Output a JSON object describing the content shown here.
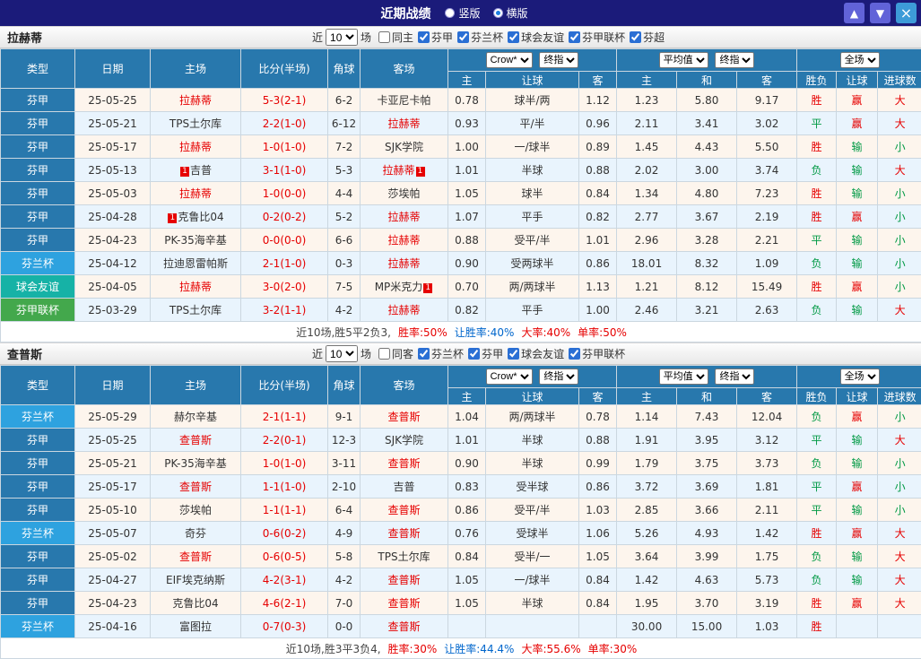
{
  "colors": {
    "win": "#e60000",
    "lose": "#009944",
    "blue": "#0066cc",
    "dark": "#444444"
  },
  "titlebar": {
    "title": "近期战绩",
    "radios": [
      {
        "label": "竖版",
        "selected": false
      },
      {
        "label": "横版",
        "selected": true
      }
    ],
    "buttons": {
      "up": "▲",
      "down": "▼",
      "close": "×"
    }
  },
  "sections": [
    {
      "team": "拉赫蒂",
      "filter": {
        "near": "近",
        "count": "10",
        "games": "场",
        "checks": [
          {
            "label": "同主",
            "checked": false
          },
          {
            "label": "芬甲",
            "checked": true
          },
          {
            "label": "芬兰杯",
            "checked": true
          },
          {
            "label": "球会友谊",
            "checked": true
          },
          {
            "label": "芬甲联杯",
            "checked": true
          },
          {
            "label": "芬超",
            "checked": true
          }
        ]
      },
      "header": {
        "type": "类型",
        "date": "日期",
        "home": "主场",
        "score": "比分(半场)",
        "corner": "角球",
        "away": "客场",
        "odds_selects": [
          "Crow*",
          "终指"
        ],
        "avg_selects": [
          "平均值",
          "终指"
        ],
        "full_select": "全场",
        "sub": [
          "主",
          "让球",
          "客",
          "主",
          "和",
          "客",
          "胜负",
          "让球",
          "进球数"
        ]
      },
      "rows": [
        {
          "type": "芬甲",
          "tcls": "fj",
          "date": "25-05-25",
          "home": {
            "name": "拉赫蒂",
            "self": true
          },
          "score": "5-3(2-1)",
          "corner": "6-2",
          "away": {
            "name": "卡亚尼卡帕",
            "self": false
          },
          "odds": [
            "0.78",
            "球半/两",
            "1.12"
          ],
          "avg": [
            "1.23",
            "5.80",
            "9.17"
          ],
          "res": [
            [
              "胜",
              "r"
            ],
            [
              "赢",
              "r"
            ],
            [
              "大",
              "r"
            ]
          ]
        },
        {
          "type": "芬甲",
          "tcls": "fj",
          "date": "25-05-21",
          "home": {
            "name": "TPS土尔库",
            "self": false
          },
          "score": "2-2(1-0)",
          "corner": "6-12",
          "away": {
            "name": "拉赫蒂",
            "self": true
          },
          "odds": [
            "0.93",
            "平/半",
            "0.96"
          ],
          "avg": [
            "2.11",
            "3.41",
            "3.02"
          ],
          "res": [
            [
              "平",
              "g"
            ],
            [
              "赢",
              "r"
            ],
            [
              "大",
              "r"
            ]
          ]
        },
        {
          "type": "芬甲",
          "tcls": "fj",
          "date": "25-05-17",
          "home": {
            "name": "拉赫蒂",
            "self": true
          },
          "score": "1-0(1-0)",
          "corner": "7-2",
          "away": {
            "name": "SJK学院",
            "self": false
          },
          "odds": [
            "1.00",
            "一/球半",
            "0.89"
          ],
          "avg": [
            "1.45",
            "4.43",
            "5.50"
          ],
          "res": [
            [
              "胜",
              "r"
            ],
            [
              "输",
              "g"
            ],
            [
              "小",
              "g"
            ]
          ]
        },
        {
          "type": "芬甲",
          "tcls": "fj",
          "date": "25-05-13",
          "home": {
            "name": "吉普",
            "self": false,
            "card_before": "1"
          },
          "score": "3-1(1-0)",
          "corner": "5-3",
          "away": {
            "name": "拉赫蒂",
            "self": true,
            "card_after": "1"
          },
          "odds": [
            "1.01",
            "半球",
            "0.88"
          ],
          "avg": [
            "2.02",
            "3.00",
            "3.74"
          ],
          "res": [
            [
              "负",
              "g"
            ],
            [
              "输",
              "g"
            ],
            [
              "大",
              "r"
            ]
          ]
        },
        {
          "type": "芬甲",
          "tcls": "fj",
          "date": "25-05-03",
          "home": {
            "name": "拉赫蒂",
            "self": true
          },
          "score": "1-0(0-0)",
          "corner": "4-4",
          "away": {
            "name": "莎埃帕",
            "self": false
          },
          "odds": [
            "1.05",
            "球半",
            "0.84"
          ],
          "avg": [
            "1.34",
            "4.80",
            "7.23"
          ],
          "res": [
            [
              "胜",
              "r"
            ],
            [
              "输",
              "g"
            ],
            [
              "小",
              "g"
            ]
          ]
        },
        {
          "type": "芬甲",
          "tcls": "fj",
          "date": "25-04-28",
          "home": {
            "name": "克鲁比04",
            "self": false,
            "card_before": "1"
          },
          "score": "0-2(0-2)",
          "corner": "5-2",
          "away": {
            "name": "拉赫蒂",
            "self": true
          },
          "odds": [
            "1.07",
            "平手",
            "0.82"
          ],
          "avg": [
            "2.77",
            "3.67",
            "2.19"
          ],
          "res": [
            [
              "胜",
              "r"
            ],
            [
              "赢",
              "r"
            ],
            [
              "小",
              "g"
            ]
          ]
        },
        {
          "type": "芬甲",
          "tcls": "fj",
          "date": "25-04-23",
          "home": {
            "name": "PK-35海辛基",
            "self": false
          },
          "score": "0-0(0-0)",
          "corner": "6-6",
          "away": {
            "name": "拉赫蒂",
            "self": true
          },
          "odds": [
            "0.88",
            "受平/半",
            "1.01"
          ],
          "avg": [
            "2.96",
            "3.28",
            "2.21"
          ],
          "res": [
            [
              "平",
              "g"
            ],
            [
              "输",
              "g"
            ],
            [
              "小",
              "g"
            ]
          ]
        },
        {
          "type": "芬兰杯",
          "tcls": "flb",
          "date": "25-04-12",
          "home": {
            "name": "拉迪恩雷帕斯",
            "self": false
          },
          "score": "2-1(1-0)",
          "corner": "0-3",
          "away": {
            "name": "拉赫蒂",
            "self": true
          },
          "odds": [
            "0.90",
            "受两球半",
            "0.86"
          ],
          "avg": [
            "18.01",
            "8.32",
            "1.09"
          ],
          "res": [
            [
              "负",
              "g"
            ],
            [
              "输",
              "g"
            ],
            [
              "小",
              "g"
            ]
          ]
        },
        {
          "type": "球会友谊",
          "tcls": "qhyy",
          "date": "25-04-05",
          "home": {
            "name": "拉赫蒂",
            "self": true
          },
          "score": "3-0(2-0)",
          "corner": "7-5",
          "away": {
            "name": "MP米克力",
            "self": false,
            "card_after": "1"
          },
          "odds": [
            "0.70",
            "两/两球半",
            "1.13"
          ],
          "avg": [
            "1.21",
            "8.12",
            "15.49"
          ],
          "res": [
            [
              "胜",
              "r"
            ],
            [
              "赢",
              "r"
            ],
            [
              "小",
              "g"
            ]
          ]
        },
        {
          "type": "芬甲联杯",
          "tcls": "fjlb",
          "date": "25-03-29",
          "home": {
            "name": "TPS土尔库",
            "self": false
          },
          "score": "3-2(1-1)",
          "corner": "4-2",
          "away": {
            "name": "拉赫蒂",
            "self": true
          },
          "odds": [
            "0.82",
            "平手",
            "1.00"
          ],
          "avg": [
            "2.46",
            "3.21",
            "2.63"
          ],
          "res": [
            [
              "负",
              "g"
            ],
            [
              "输",
              "g"
            ],
            [
              "大",
              "r"
            ]
          ]
        }
      ],
      "footer": [
        {
          "text": "近10场,胜5平2负3,",
          "color": "#444444"
        },
        {
          "text": "胜率:50%",
          "color": "#e60000"
        },
        {
          "text": "让胜率:40%",
          "color": "#0066cc"
        },
        {
          "text": "大率:40%",
          "color": "#e60000"
        },
        {
          "text": "单率:50%",
          "color": "#e60000"
        }
      ]
    },
    {
      "team": "查普斯",
      "filter": {
        "near": "近",
        "count": "10",
        "games": "场",
        "checks": [
          {
            "label": "同客",
            "checked": false
          },
          {
            "label": "芬兰杯",
            "checked": true
          },
          {
            "label": "芬甲",
            "checked": true
          },
          {
            "label": "球会友谊",
            "checked": true
          },
          {
            "label": "芬甲联杯",
            "checked": true
          }
        ]
      },
      "header": {
        "type": "类型",
        "date": "日期",
        "home": "主场",
        "score": "比分(半场)",
        "corner": "角球",
        "away": "客场",
        "odds_selects": [
          "Crow*",
          "终指"
        ],
        "avg_selects": [
          "平均值",
          "终指"
        ],
        "full_select": "全场",
        "sub": [
          "主",
          "让球",
          "客",
          "主",
          "和",
          "客",
          "胜负",
          "让球",
          "进球数"
        ]
      },
      "rows": [
        {
          "type": "芬兰杯",
          "tcls": "flb",
          "date": "25-05-29",
          "home": {
            "name": "赫尔辛基",
            "self": false
          },
          "score": "2-1(1-1)",
          "corner": "9-1",
          "away": {
            "name": "查普斯",
            "self": true
          },
          "odds": [
            "1.04",
            "两/两球半",
            "0.78"
          ],
          "avg": [
            "1.14",
            "7.43",
            "12.04"
          ],
          "res": [
            [
              "负",
              "g"
            ],
            [
              "赢",
              "r"
            ],
            [
              "小",
              "g"
            ]
          ]
        },
        {
          "type": "芬甲",
          "tcls": "fj",
          "date": "25-05-25",
          "home": {
            "name": "查普斯",
            "self": true
          },
          "score": "2-2(0-1)",
          "corner": "12-3",
          "away": {
            "name": "SJK学院",
            "self": false
          },
          "odds": [
            "1.01",
            "半球",
            "0.88"
          ],
          "avg": [
            "1.91",
            "3.95",
            "3.12"
          ],
          "res": [
            [
              "平",
              "g"
            ],
            [
              "输",
              "g"
            ],
            [
              "大",
              "r"
            ]
          ]
        },
        {
          "type": "芬甲",
          "tcls": "fj",
          "date": "25-05-21",
          "home": {
            "name": "PK-35海辛基",
            "self": false
          },
          "score": "1-0(1-0)",
          "corner": "3-11",
          "away": {
            "name": "查普斯",
            "self": true
          },
          "odds": [
            "0.90",
            "半球",
            "0.99"
          ],
          "avg": [
            "1.79",
            "3.75",
            "3.73"
          ],
          "res": [
            [
              "负",
              "g"
            ],
            [
              "输",
              "g"
            ],
            [
              "小",
              "g"
            ]
          ]
        },
        {
          "type": "芬甲",
          "tcls": "fj",
          "date": "25-05-17",
          "home": {
            "name": "查普斯",
            "self": true
          },
          "score": "1-1(1-0)",
          "corner": "2-10",
          "away": {
            "name": "吉普",
            "self": false
          },
          "odds": [
            "0.83",
            "受半球",
            "0.86"
          ],
          "avg": [
            "3.72",
            "3.69",
            "1.81"
          ],
          "res": [
            [
              "平",
              "g"
            ],
            [
              "赢",
              "r"
            ],
            [
              "小",
              "g"
            ]
          ]
        },
        {
          "type": "芬甲",
          "tcls": "fj",
          "date": "25-05-10",
          "home": {
            "name": "莎埃帕",
            "self": false
          },
          "score": "1-1(1-1)",
          "corner": "6-4",
          "away": {
            "name": "查普斯",
            "self": true
          },
          "odds": [
            "0.86",
            "受平/半",
            "1.03"
          ],
          "avg": [
            "2.85",
            "3.66",
            "2.11"
          ],
          "res": [
            [
              "平",
              "g"
            ],
            [
              "输",
              "g"
            ],
            [
              "小",
              "g"
            ]
          ]
        },
        {
          "type": "芬兰杯",
          "tcls": "flb",
          "date": "25-05-07",
          "home": {
            "name": "奇芬",
            "self": false
          },
          "score": "0-6(0-2)",
          "corner": "4-9",
          "away": {
            "name": "查普斯",
            "self": true
          },
          "odds": [
            "0.76",
            "受球半",
            "1.06"
          ],
          "avg": [
            "5.26",
            "4.93",
            "1.42"
          ],
          "res": [
            [
              "胜",
              "r"
            ],
            [
              "赢",
              "r"
            ],
            [
              "大",
              "r"
            ]
          ]
        },
        {
          "type": "芬甲",
          "tcls": "fj",
          "date": "25-05-02",
          "home": {
            "name": "查普斯",
            "self": true
          },
          "score": "0-6(0-5)",
          "corner": "5-8",
          "away": {
            "name": "TPS土尔库",
            "self": false
          },
          "odds": [
            "0.84",
            "受半/一",
            "1.05"
          ],
          "avg": [
            "3.64",
            "3.99",
            "1.75"
          ],
          "res": [
            [
              "负",
              "g"
            ],
            [
              "输",
              "g"
            ],
            [
              "大",
              "r"
            ]
          ]
        },
        {
          "type": "芬甲",
          "tcls": "fj",
          "date": "25-04-27",
          "home": {
            "name": "EIF埃克纳斯",
            "self": false
          },
          "score": "4-2(3-1)",
          "corner": "4-2",
          "away": {
            "name": "查普斯",
            "self": true
          },
          "odds": [
            "1.05",
            "一/球半",
            "0.84"
          ],
          "avg": [
            "1.42",
            "4.63",
            "5.73"
          ],
          "res": [
            [
              "负",
              "g"
            ],
            [
              "输",
              "g"
            ],
            [
              "大",
              "r"
            ]
          ]
        },
        {
          "type": "芬甲",
          "tcls": "fj",
          "date": "25-04-23",
          "home": {
            "name": "克鲁比04",
            "self": false
          },
          "score": "4-6(2-1)",
          "corner": "7-0",
          "away": {
            "name": "查普斯",
            "self": true
          },
          "odds": [
            "1.05",
            "半球",
            "0.84"
          ],
          "avg": [
            "1.95",
            "3.70",
            "3.19"
          ],
          "res": [
            [
              "胜",
              "r"
            ],
            [
              "赢",
              "r"
            ],
            [
              "大",
              "r"
            ]
          ]
        },
        {
          "type": "芬兰杯",
          "tcls": "flb",
          "date": "25-04-16",
          "home": {
            "name": "富图拉",
            "self": false
          },
          "score": "0-7(0-3)",
          "corner": "0-0",
          "away": {
            "name": "查普斯",
            "self": true
          },
          "odds": [
            "",
            "",
            ""
          ],
          "avg": [
            "30.00",
            "15.00",
            "1.03"
          ],
          "res": [
            [
              "胜",
              "r"
            ],
            [
              "",
              ""
            ],
            [
              "",
              ""
            ]
          ]
        }
      ],
      "footer": [
        {
          "text": "近10场,胜3平3负4,",
          "color": "#444444"
        },
        {
          "text": "胜率:30%",
          "color": "#e60000"
        },
        {
          "text": "让胜率:44.4%",
          "color": "#0066cc"
        },
        {
          "text": "大率:55.6%",
          "color": "#e60000"
        },
        {
          "text": "单率:30%",
          "color": "#e60000"
        }
      ]
    }
  ]
}
